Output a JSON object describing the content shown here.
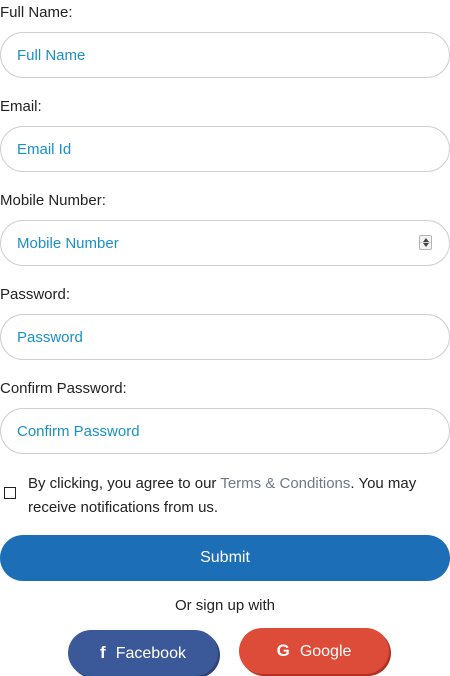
{
  "form": {
    "full_name": {
      "label": "Full Name:",
      "placeholder": "Full Name",
      "value": ""
    },
    "email": {
      "label": "Email:",
      "placeholder": "Email Id",
      "value": ""
    },
    "mobile": {
      "label": "Mobile Number:",
      "placeholder": "Mobile Number",
      "value": ""
    },
    "password": {
      "label": "Password:",
      "placeholder": "Password",
      "value": ""
    },
    "confirm_password": {
      "label": "Confirm Password:",
      "placeholder": "Confirm Password",
      "value": ""
    },
    "agree": {
      "checked": false,
      "text_before": "By clicking, you agree to our ",
      "link_text": "Terms & Conditions",
      "text_after": ". You may receive notifications from us."
    },
    "submit_label": "Submit",
    "or_text": "Or sign up with"
  },
  "social": {
    "facebook": {
      "label": "Facebook",
      "icon": "facebook-icon",
      "glyph": "f",
      "color": "#3b5998"
    },
    "google": {
      "label": "Google",
      "icon": "google-icon",
      "glyph": "G",
      "color": "#dd4b39"
    }
  },
  "colors": {
    "accent": "#1c6fb7",
    "placeholder": "#1a90c8",
    "link": "#6d7a86"
  }
}
